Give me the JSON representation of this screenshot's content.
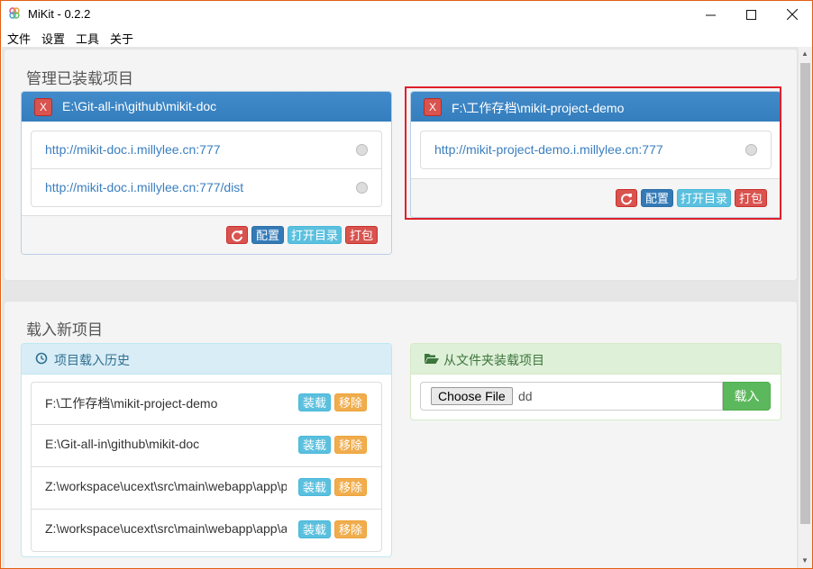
{
  "window": {
    "title": "MiKit - 0.2.2"
  },
  "menu": [
    "文件",
    "设置",
    "工具",
    "关于"
  ],
  "loaded": {
    "title": "管理已装载项目",
    "projects": [
      {
        "path": "E:\\Git-all-in\\github\\mikit-doc",
        "close": "X",
        "urls": [
          "http://mikit-doc.i.millylee.cn:777",
          "http://mikit-doc.i.millylee.cn:777/dist"
        ]
      },
      {
        "path": "F:\\工作存档\\mikit-project-demo",
        "close": "X",
        "urls": [
          "http://mikit-project-demo.i.millylee.cn:777"
        ]
      }
    ],
    "buttons": {
      "config": "配置",
      "open_dir": "打开目录",
      "pack": "打包"
    }
  },
  "new_project": {
    "title": "载入新项目",
    "history": {
      "title": "项目载入历史",
      "load_label": "装载",
      "remove_label": "移除",
      "items": [
        "F:\\工作存档\\mikit-project-demo",
        "E:\\Git-all-in\\github\\mikit-doc",
        "Z:\\workspace\\ucext\\src\\main\\webapp\\app\\p",
        "Z:\\workspace\\ucext\\src\\main\\webapp\\app\\a"
      ]
    },
    "folder": {
      "title": "从文件夹装载项目",
      "choose_file": "Choose File",
      "file_value": "dd",
      "load_button": "载入"
    }
  }
}
